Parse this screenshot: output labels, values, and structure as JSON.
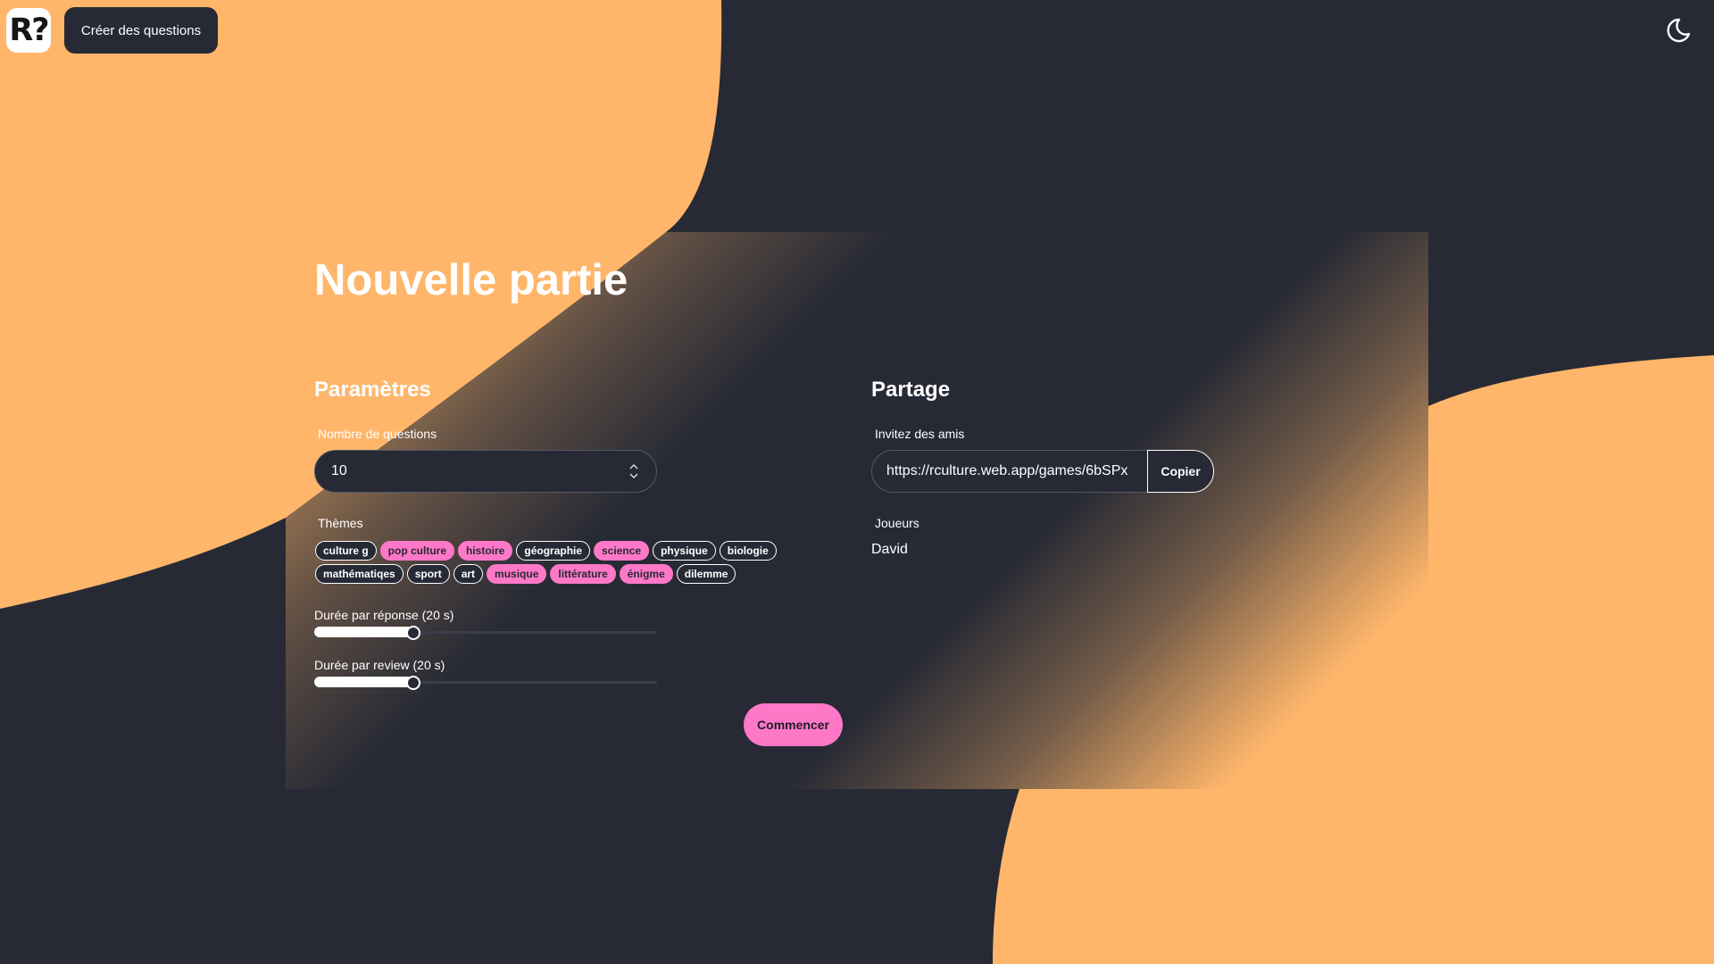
{
  "colors": {
    "background": "#272a35",
    "accent_orange": "#ffb66b",
    "accent_pink": "#ff78c8",
    "text": "#ffffff"
  },
  "header": {
    "logo_text": "R?",
    "create_button_label": "Créer des questions",
    "theme_toggle_icon": "moon-icon"
  },
  "main": {
    "title": "Nouvelle partie",
    "settings": {
      "section_title": "Paramètres",
      "question_count_label": "Nombre de questions",
      "question_count_value": "10",
      "themes_label": "Thèmes",
      "themes": [
        {
          "label": "culture g",
          "selected": false
        },
        {
          "label": "pop culture",
          "selected": true
        },
        {
          "label": "histoire",
          "selected": true
        },
        {
          "label": "géographie",
          "selected": false
        },
        {
          "label": "science",
          "selected": true
        },
        {
          "label": "physique",
          "selected": false
        },
        {
          "label": "biologie",
          "selected": false
        },
        {
          "label": "mathématiqes",
          "selected": false
        },
        {
          "label": "sport",
          "selected": false
        },
        {
          "label": "art",
          "selected": false
        },
        {
          "label": "musique",
          "selected": true
        },
        {
          "label": "littérature",
          "selected": true
        },
        {
          "label": "énigme",
          "selected": true
        },
        {
          "label": "dilemme",
          "selected": false
        }
      ],
      "answer_duration_label": "Durée par réponse (20 s)",
      "answer_duration_fraction": 0.29,
      "review_duration_label": "Durée par review (20 s)",
      "review_duration_fraction": 0.29,
      "start_button_label": "Commencer"
    },
    "share": {
      "section_title": "Partage",
      "invite_label": "Invitez des amis",
      "invite_url": "https://rculture.web.app/games/6bSPx",
      "copy_button_label": "Copier",
      "players_label": "Joueurs",
      "players": [
        "David"
      ]
    }
  }
}
